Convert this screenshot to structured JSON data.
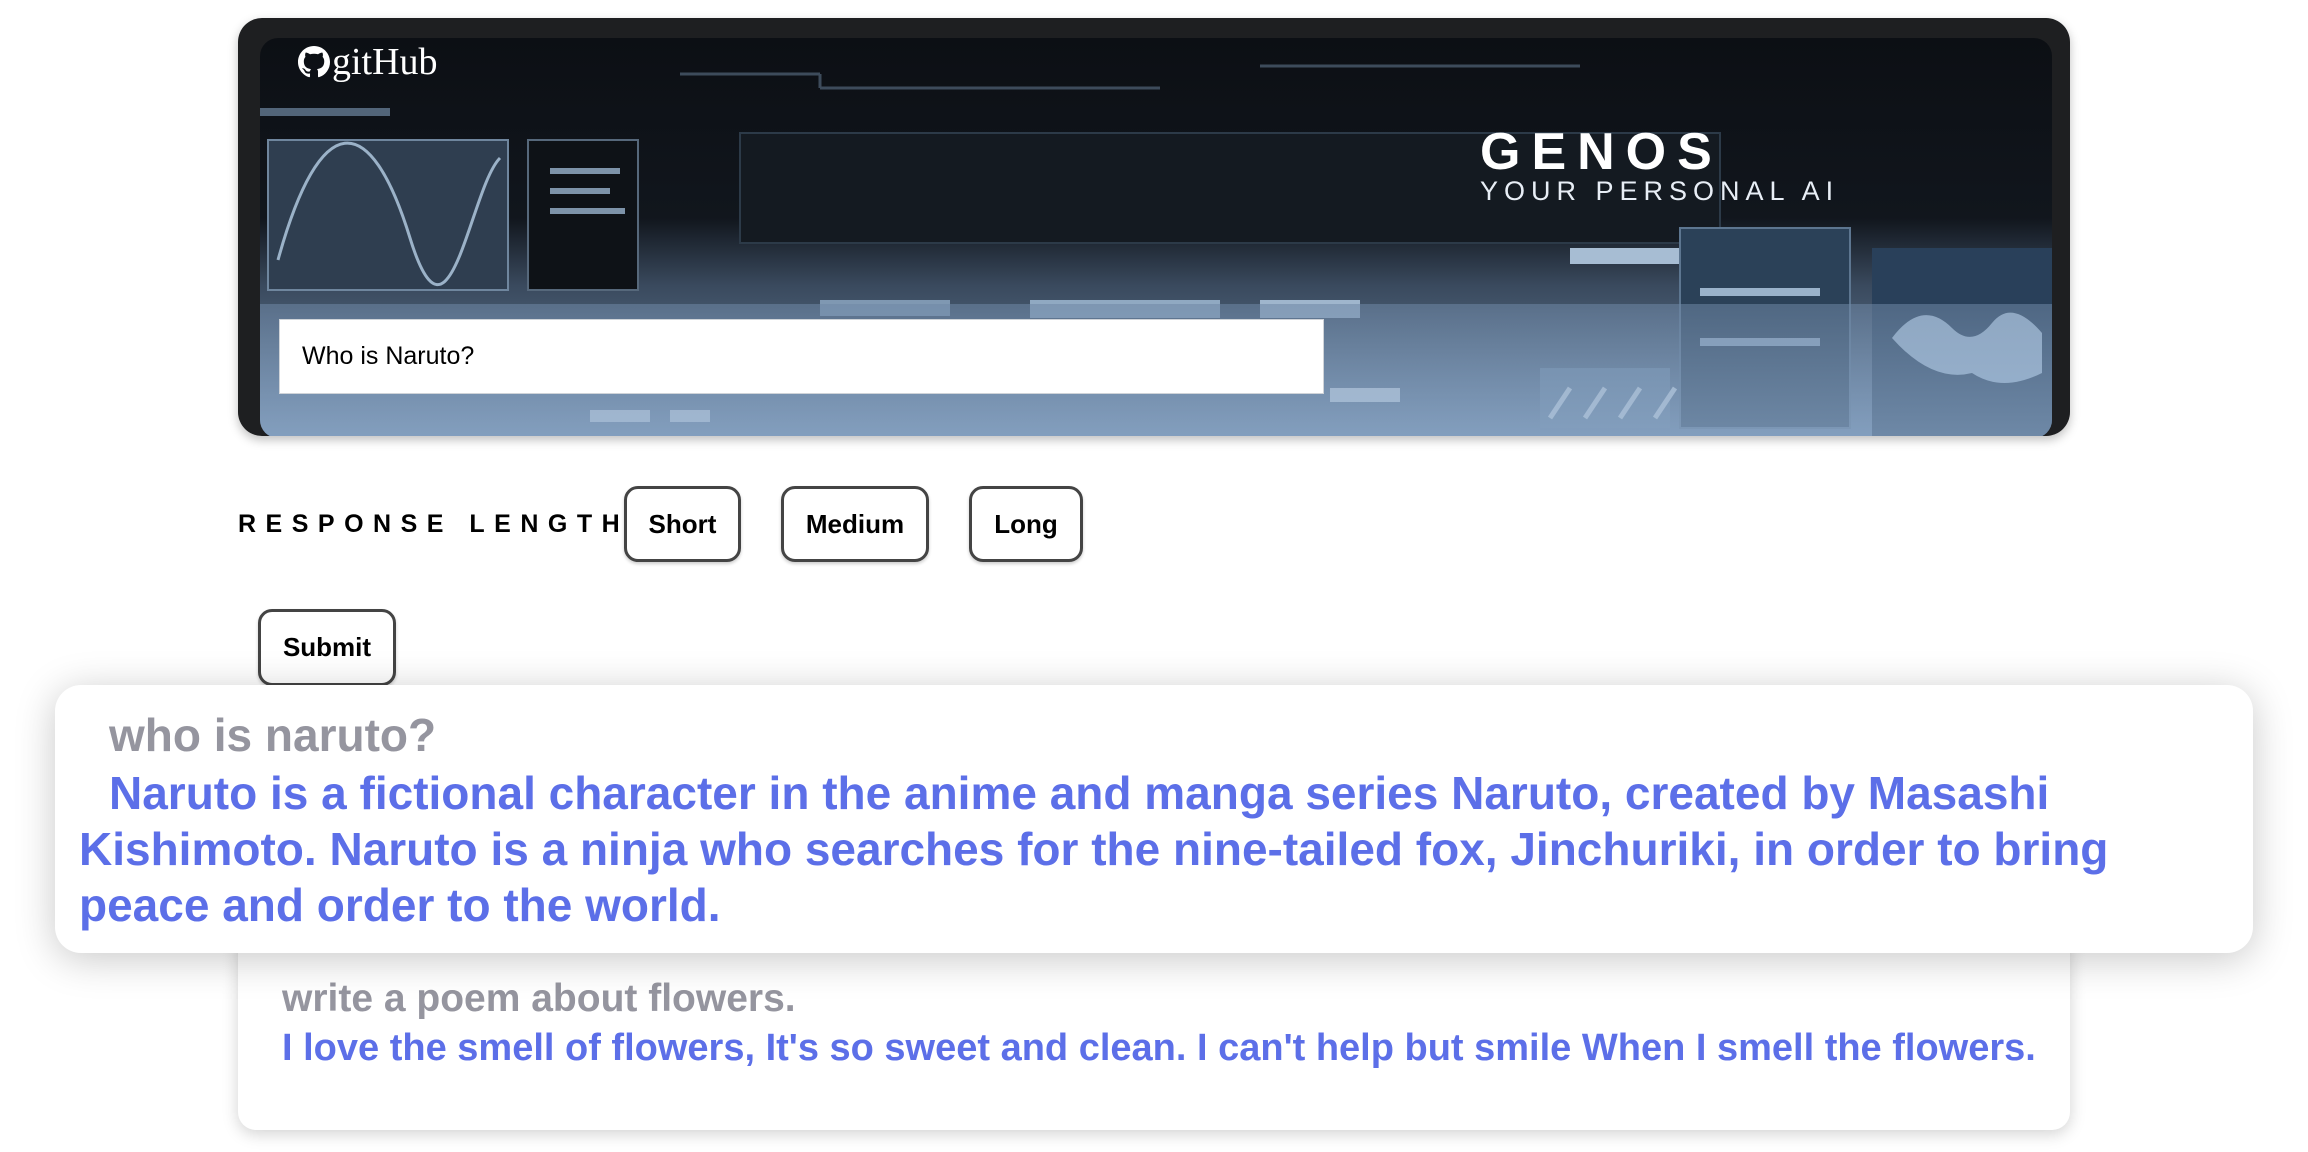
{
  "header": {
    "github_label": "gitHub",
    "brand_title": "GENOS",
    "brand_subtitle": "YOUR PERSONAL AI"
  },
  "query": {
    "value": "Who is Naruto?"
  },
  "response_length": {
    "label": "RESPONSE LENGTH",
    "options": [
      "Short",
      "Medium",
      "Long"
    ]
  },
  "submit": {
    "label": "Submit"
  },
  "responses": [
    {
      "question": "who is naruto?",
      "answer": "Naruto is a fictional character in the anime and manga series Naruto, created by Masashi Kishimoto. Naruto is a ninja who searches for the nine-tailed fox, Jinchuriki, in order to bring peace and order to the world."
    },
    {
      "question": "write a poem about flowers.",
      "answer": "I love the smell of flowers, It's so sweet and clean. I can't help but smile When I smell the flowers."
    }
  ],
  "colors": {
    "question_text": "#95959f",
    "answer_text": "#5c6fe8",
    "hero_frame": "#1e1f21"
  }
}
